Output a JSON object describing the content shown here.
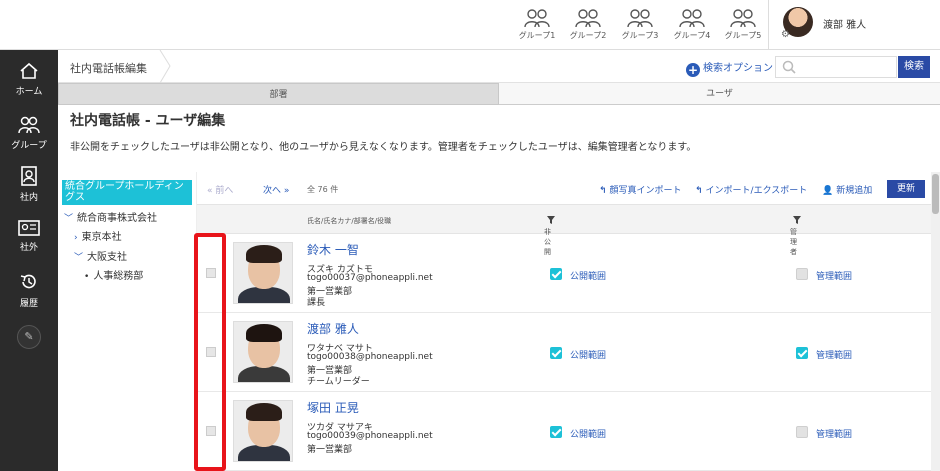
{
  "topbar": {
    "groups": [
      {
        "label": "グループ1"
      },
      {
        "label": "グループ2"
      },
      {
        "label": "グループ3"
      },
      {
        "label": "グループ4"
      },
      {
        "label": "グループ5"
      }
    ],
    "user_name": "渡部 雅人"
  },
  "rail": {
    "items": [
      {
        "label": "ホーム",
        "icon": "home-icon"
      },
      {
        "label": "グループ",
        "icon": "group-icon"
      },
      {
        "label": "社内",
        "icon": "directory-icon"
      },
      {
        "label": "社外",
        "icon": "contact-card-icon"
      },
      {
        "label": "履歴",
        "icon": "history-icon"
      }
    ]
  },
  "header": {
    "breadcrumb": "社内電話帳編集",
    "search_option": "検索オプション",
    "search_placeholder": "",
    "search_button": "検索"
  },
  "tabs": [
    {
      "label": "部署"
    },
    {
      "label": "ユーザ"
    }
  ],
  "page": {
    "title": "社内電話帳 - ユーザ編集",
    "description": "非公開をチェックしたユーザは非公開となり、他のユーザから見えなくなります。管理者をチェックしたユーザは、編集管理者となります。"
  },
  "tree": {
    "root": "統合グループホールディングス",
    "nodes": [
      {
        "label": "統合商事株式会社",
        "caret": "﹀"
      },
      {
        "label": "東京本社",
        "caret": "›"
      },
      {
        "label": "大阪支社",
        "caret": "﹀"
      },
      {
        "label": "人事総務部",
        "caret": "•"
      }
    ]
  },
  "list": {
    "prev": "前へ",
    "next": "次へ",
    "count": "全 76 件",
    "actions": {
      "photo_import": "顔写真インポート",
      "import_export": "インポート/エクスポート",
      "add_new": "新規追加",
      "update": "更新"
    },
    "columns": {
      "name": "氏名/氏名カナ/部署名/役職",
      "private": "非公開",
      "admin": "管理者"
    },
    "rows": [
      {
        "name": "鈴木 一智",
        "kana": "スズキ カズトモ",
        "email": "togo00037@phoneappli.net",
        "dept": "第一営業部",
        "title": "課長",
        "private_checked": true,
        "private_label": "公開範囲",
        "admin_checked": false,
        "admin_label": "管理範囲"
      },
      {
        "name": "渡部 雅人",
        "kana": "ワタナベ マサト",
        "email": "togo00038@phoneappli.net",
        "dept": "第一営業部",
        "title": "チームリーダー",
        "private_checked": true,
        "private_label": "公開範囲",
        "admin_checked": true,
        "admin_label": "管理範囲"
      },
      {
        "name": "塚田 正晃",
        "kana": "ツカダ マサアキ",
        "email": "togo00039@phoneappli.net",
        "dept": "第一営業部",
        "title": "",
        "private_checked": true,
        "private_label": "公開範囲",
        "admin_checked": false,
        "admin_label": "管理範囲"
      }
    ]
  },
  "colors": {
    "accent": "#2a5bb8",
    "button": "#2a4aa5",
    "teal": "#1dc1d7",
    "highlight": "#e8141a",
    "rail": "#2b2b2b"
  }
}
